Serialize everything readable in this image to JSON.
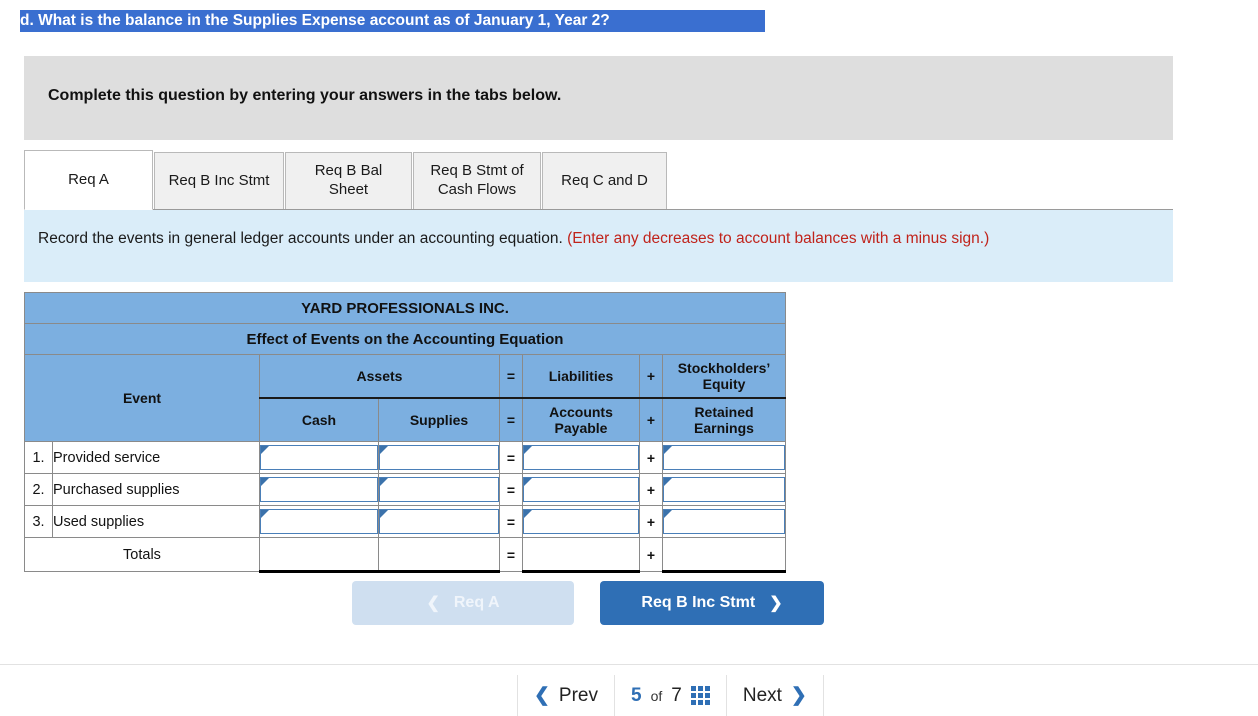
{
  "top_question": "d. What is the balance in the Supplies Expense account as of January 1, Year 2?",
  "banner": {
    "text": "Complete this question by entering your answers in the tabs below."
  },
  "tabs": [
    {
      "label": "Req A",
      "active": true
    },
    {
      "label": "Req B Inc Stmt",
      "active": false
    },
    {
      "label": "Req B Bal Sheet",
      "active": false
    },
    {
      "label": "Req B Stmt of Cash Flows",
      "active": false
    },
    {
      "label": "Req C and D",
      "active": false
    }
  ],
  "instruction": {
    "black": "Record the events in general ledger accounts under an accounting equation. ",
    "red": "(Enter any decreases to account balances with a minus sign.)"
  },
  "table": {
    "company": "YARD PROFESSIONALS INC.",
    "subtitle": "Effect of Events on the Accounting Equation",
    "header": {
      "event": "Event",
      "assets": "Assets",
      "equals": "=",
      "liabilities": "Liabilities",
      "plus": "+",
      "stockholders_equity": "Stockholders’ Equity",
      "cash": "Cash",
      "supplies": "Supplies",
      "accounts_payable": "Accounts Payable",
      "retained_earnings": "Retained Earnings"
    },
    "rows": [
      {
        "num": "1.",
        "label": "Provided service",
        "cash": "",
        "supplies": "",
        "accounts_payable": "",
        "retained_earnings": ""
      },
      {
        "num": "2.",
        "label": "Purchased supplies",
        "cash": "",
        "supplies": "",
        "accounts_payable": "",
        "retained_earnings": ""
      },
      {
        "num": "3.",
        "label": "Used supplies",
        "cash": "",
        "supplies": "",
        "accounts_payable": "",
        "retained_earnings": ""
      }
    ],
    "totals": {
      "label": "Totals",
      "cash": "",
      "supplies": "",
      "accounts_payable": "",
      "retained_earnings": ""
    }
  },
  "req_nav": {
    "prev_label": "Req A",
    "prev_chevron": "❮",
    "next_label": "Req B Inc Stmt",
    "next_chevron": "❯"
  },
  "pager": {
    "prev_chevron": "❮",
    "prev_label": "Prev",
    "current": "5",
    "of": "of",
    "total": "7",
    "next_label": "Next",
    "next_chevron": "❯"
  },
  "colors": {
    "header_blue": "#7cafe0",
    "primary_button": "#2f6fb5",
    "instruction_panel": "#daedf9",
    "banner_grey": "#dedede",
    "red_text": "#c0231b",
    "highlight_blue": "#3a6fd0"
  }
}
